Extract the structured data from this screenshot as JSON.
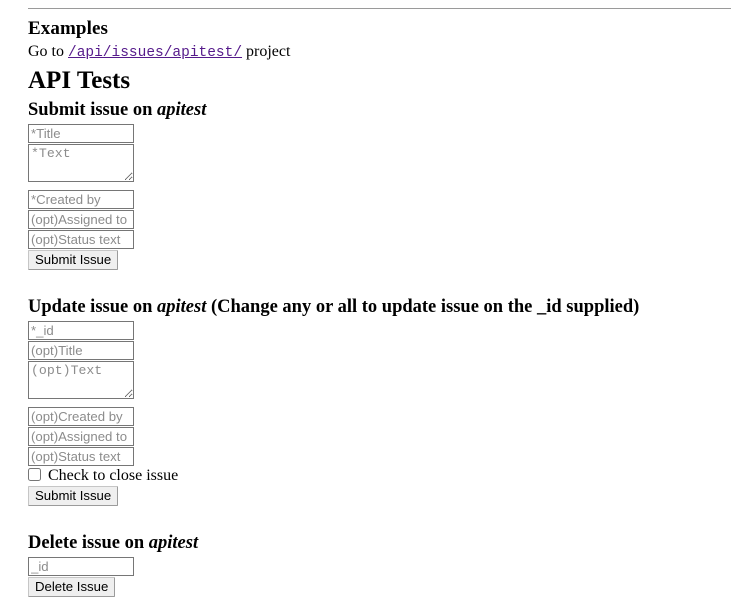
{
  "page": {
    "examples_heading": "Examples",
    "goto_prefix": "Go to ",
    "goto_link_text": "/api/issues/apitest/",
    "goto_suffix": " project",
    "api_tests_heading": "API Tests",
    "link_color": "#551a8b",
    "border_color": "#767676",
    "placeholder_color": "#8c8c8c",
    "button_background": "#efefef"
  },
  "submit_form": {
    "heading_prefix": "Submit issue on ",
    "heading_project": "apitest",
    "heading_suffix": "",
    "fields": {
      "title_placeholder": "*Title",
      "text_placeholder": "*Text",
      "created_by_placeholder": "*Created by",
      "assigned_to_placeholder": "(opt)Assigned to",
      "status_text_placeholder": "(opt)Status text"
    },
    "values": {
      "title": "",
      "text": "",
      "created_by": "",
      "assigned_to": "",
      "status_text": ""
    },
    "submit_label": "Submit Issue"
  },
  "update_form": {
    "heading_prefix": "Update issue on ",
    "heading_project": "apitest",
    "heading_suffix": " (Change any or all to update issue on the _id supplied)",
    "fields": {
      "id_placeholder": "*_id",
      "title_placeholder": "(opt)Title",
      "text_placeholder": "(opt)Text",
      "created_by_placeholder": "(opt)Created by",
      "assigned_to_placeholder": "(opt)Assigned to",
      "status_text_placeholder": "(opt)Status text"
    },
    "values": {
      "id": "",
      "title": "",
      "text": "",
      "created_by": "",
      "assigned_to": "",
      "status_text": ""
    },
    "close_checkbox_label": "Check to close issue",
    "close_checkbox_checked": false,
    "submit_label": "Submit Issue"
  },
  "delete_form": {
    "heading_prefix": "Delete issue on ",
    "heading_project": "apitest",
    "heading_suffix": "",
    "fields": {
      "id_placeholder": "_id"
    },
    "values": {
      "id": ""
    },
    "submit_label": "Delete Issue"
  }
}
